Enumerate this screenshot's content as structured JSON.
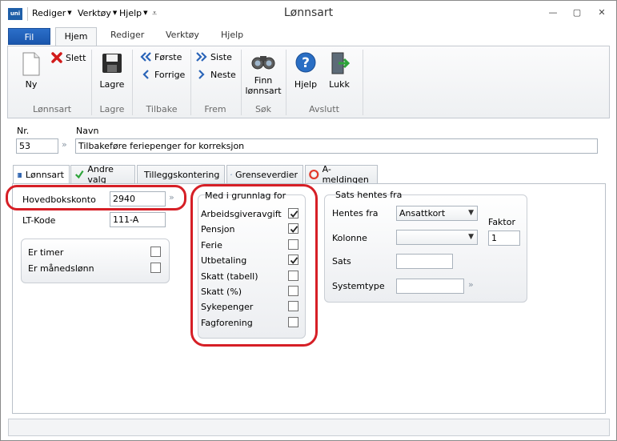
{
  "window": {
    "title": "Lønnsart",
    "quick_access": [
      {
        "label": "Rediger"
      },
      {
        "label": "Verktøy"
      },
      {
        "label": "Hjelp"
      }
    ],
    "app_icon_text": "uni"
  },
  "ribbon": {
    "file_tab": "Fil",
    "tabs": [
      "Hjem",
      "Rediger",
      "Verktøy",
      "Hjelp"
    ],
    "active_tab": "Hjem",
    "groups": {
      "lonnsart": {
        "label": "Lønnsart",
        "new": "Ny",
        "delete": "Slett"
      },
      "lagre": {
        "label": "Lagre",
        "save": "Lagre"
      },
      "tilbake": {
        "label": "Tilbake",
        "first": "Første",
        "previous": "Forrige"
      },
      "frem": {
        "label": "Frem",
        "last": "Siste",
        "next": "Neste"
      },
      "sok": {
        "label": "Søk",
        "find_line1": "Finn",
        "find_line2": "lønnsart"
      },
      "avslutt": {
        "label": "Avslutt",
        "help": "Hjelp",
        "close": "Lukk"
      }
    }
  },
  "header": {
    "nr_label": "Nr.",
    "nr_value": "53",
    "navn_label": "Navn",
    "navn_value": "Tilbakeføre feriepenger for korreksjon"
  },
  "doc_tabs": [
    {
      "label": "Lønnsart"
    },
    {
      "label": "Andre valg"
    },
    {
      "label": "Tilleggskontering"
    },
    {
      "label": "Grenseverdier"
    },
    {
      "label": "A-meldingen"
    }
  ],
  "left": {
    "hovedbokskonto_label": "Hovedbokskonto",
    "hovedbokskonto_value": "2940",
    "ltkode_label": "LT-Kode",
    "ltkode_value": "111-A",
    "er_timer_label": "Er timer",
    "er_timer": false,
    "er_manedslonn_label": "Er månedslønn",
    "er_manedslonn": false
  },
  "grunnlag": {
    "title": "Med i grunnlag for",
    "items": [
      {
        "label": "Arbeidsgiveravgift",
        "checked": true
      },
      {
        "label": "Pensjon",
        "checked": true
      },
      {
        "label": "Ferie",
        "checked": false
      },
      {
        "label": "Utbetaling",
        "checked": true
      },
      {
        "label": "Skatt (tabell)",
        "checked": false
      },
      {
        "label": "Skatt (%)",
        "checked": false
      },
      {
        "label": "Sykepenger",
        "checked": false
      },
      {
        "label": "Fagforening",
        "checked": false
      }
    ]
  },
  "sats": {
    "title": "Sats hentes fra",
    "hentes_fra_label": "Hentes fra",
    "hentes_fra_value": "Ansattkort",
    "faktor_label": "Faktor",
    "faktor_value": "1",
    "kolonne_label": "Kolonne",
    "kolonne_value": "",
    "sats_label": "Sats",
    "sats_value": "",
    "systemtype_label": "Systemtype",
    "systemtype_value": ""
  },
  "colors": {
    "highlight_red": "#d61f26",
    "file_tab_blue": "#1a56ad"
  }
}
